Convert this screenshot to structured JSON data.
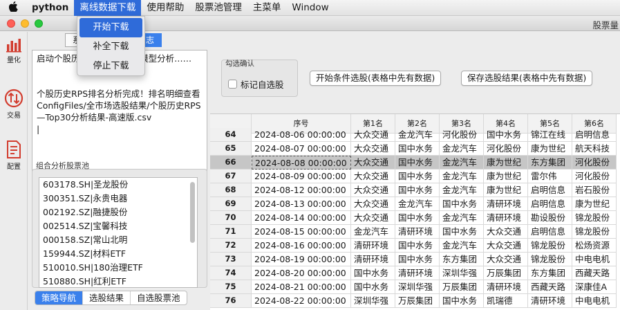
{
  "menubar": {
    "apple": "",
    "items": [
      "python",
      "离线数据下载",
      "使用帮助",
      "股票池管理",
      "主菜单",
      "Window"
    ],
    "active_index": 1
  },
  "dropdown": {
    "items": [
      "开始下载",
      "补全下载",
      "停止下载"
    ],
    "highlighted_index": 0
  },
  "window": {
    "title": "股票量"
  },
  "sidebar": {
    "items": [
      {
        "label": "量化",
        "icon": "bar-chart-icon"
      },
      {
        "label": "交易",
        "icon": "exchange-icon"
      },
      {
        "label": "配置",
        "icon": "document-icon"
      }
    ]
  },
  "left": {
    "top_tabs": [
      "系",
      "日志"
    ],
    "log_text": "启动个股历史RPS排名分析模型分析……\n\n\n个股历史RPS排名分析完成！排名明细查看ConfigFiles/全市场选股结果/个股历史RPS—Top30分析结果-高速版.csv\n|",
    "pool_label": "组合分析股票池",
    "pool_items": [
      "603178.SH|圣龙股份",
      "300351.SZ|永贵电器",
      "002192.SZ|融捷股份",
      "002514.SZ|宝馨科技",
      "000158.SZ|常山北明",
      "159944.SZ|材料ETF",
      "510010.SH|180治理ETF",
      "510880.SH|红利ETF"
    ],
    "bottom_tabs": [
      "策略导航",
      "选股结果",
      "自选股票池"
    ],
    "bottom_selected": 0
  },
  "right": {
    "select_group_label": "勾选确认",
    "checkbox_label": "标记自选股",
    "btn_start": "开始条件选股(表格中先有数据)",
    "btn_save": "保存选股结果(表格中先有数据)"
  },
  "table": {
    "headers": [
      "序号",
      "第1名",
      "第2名",
      "第3名",
      "第4名",
      "第5名",
      "第6名"
    ],
    "highlight_row": 2,
    "rows": [
      {
        "idx": "64",
        "date": "2024-08-06 00:00:00",
        "c": [
          "大众交通",
          "金龙汽车",
          "河化股份",
          "国中水务",
          "锦江在线",
          "启明信息"
        ]
      },
      {
        "idx": "65",
        "date": "2024-08-07 00:00:00",
        "c": [
          "大众交通",
          "国中水务",
          "金龙汽车",
          "河化股份",
          "康为世纪",
          "航天科技"
        ]
      },
      {
        "idx": "66",
        "date": "2024-08-08 00:00:00",
        "c": [
          "大众交通",
          "国中水务",
          "金龙汽车",
          "康为世纪",
          "东方集团",
          "河化股份"
        ]
      },
      {
        "idx": "67",
        "date": "2024-08-09 00:00:00",
        "c": [
          "大众交通",
          "国中水务",
          "金龙汽车",
          "康为世纪",
          "雷尔伟",
          "河化股份"
        ]
      },
      {
        "idx": "68",
        "date": "2024-08-12 00:00:00",
        "c": [
          "大众交通",
          "国中水务",
          "金龙汽车",
          "康为世纪",
          "启明信息",
          "岩石股份"
        ]
      },
      {
        "idx": "69",
        "date": "2024-08-13 00:00:00",
        "c": [
          "大众交通",
          "金龙汽车",
          "国中水务",
          "清研环境",
          "启明信息",
          "康为世纪"
        ]
      },
      {
        "idx": "70",
        "date": "2024-08-14 00:00:00",
        "c": [
          "大众交通",
          "国中水务",
          "金龙汽车",
          "清研环境",
          "勘设股份",
          "锦龙股份"
        ]
      },
      {
        "idx": "71",
        "date": "2024-08-15 00:00:00",
        "c": [
          "金龙汽车",
          "清研环境",
          "国中水务",
          "大众交通",
          "启明信息",
          "锦龙股份"
        ]
      },
      {
        "idx": "72",
        "date": "2024-08-16 00:00:00",
        "c": [
          "清研环境",
          "国中水务",
          "金龙汽车",
          "大众交通",
          "锦龙股份",
          "松炀资源"
        ]
      },
      {
        "idx": "73",
        "date": "2024-08-19 00:00:00",
        "c": [
          "清研环境",
          "国中水务",
          "东方集团",
          "大众交通",
          "锦龙股份",
          "中电电机"
        ]
      },
      {
        "idx": "74",
        "date": "2024-08-20 00:00:00",
        "c": [
          "国中水务",
          "清研环境",
          "深圳华强",
          "万辰集团",
          "东方集团",
          "西藏天路"
        ]
      },
      {
        "idx": "75",
        "date": "2024-08-21 00:00:00",
        "c": [
          "国中水务",
          "深圳华强",
          "万辰集团",
          "清研环境",
          "西藏天路",
          "深康佳A"
        ]
      },
      {
        "idx": "76",
        "date": "2024-08-22 00:00:00",
        "c": [
          "深圳华强",
          "万辰集团",
          "国中水务",
          "凯瑞德",
          "清研环境",
          "中电电机"
        ]
      }
    ]
  }
}
